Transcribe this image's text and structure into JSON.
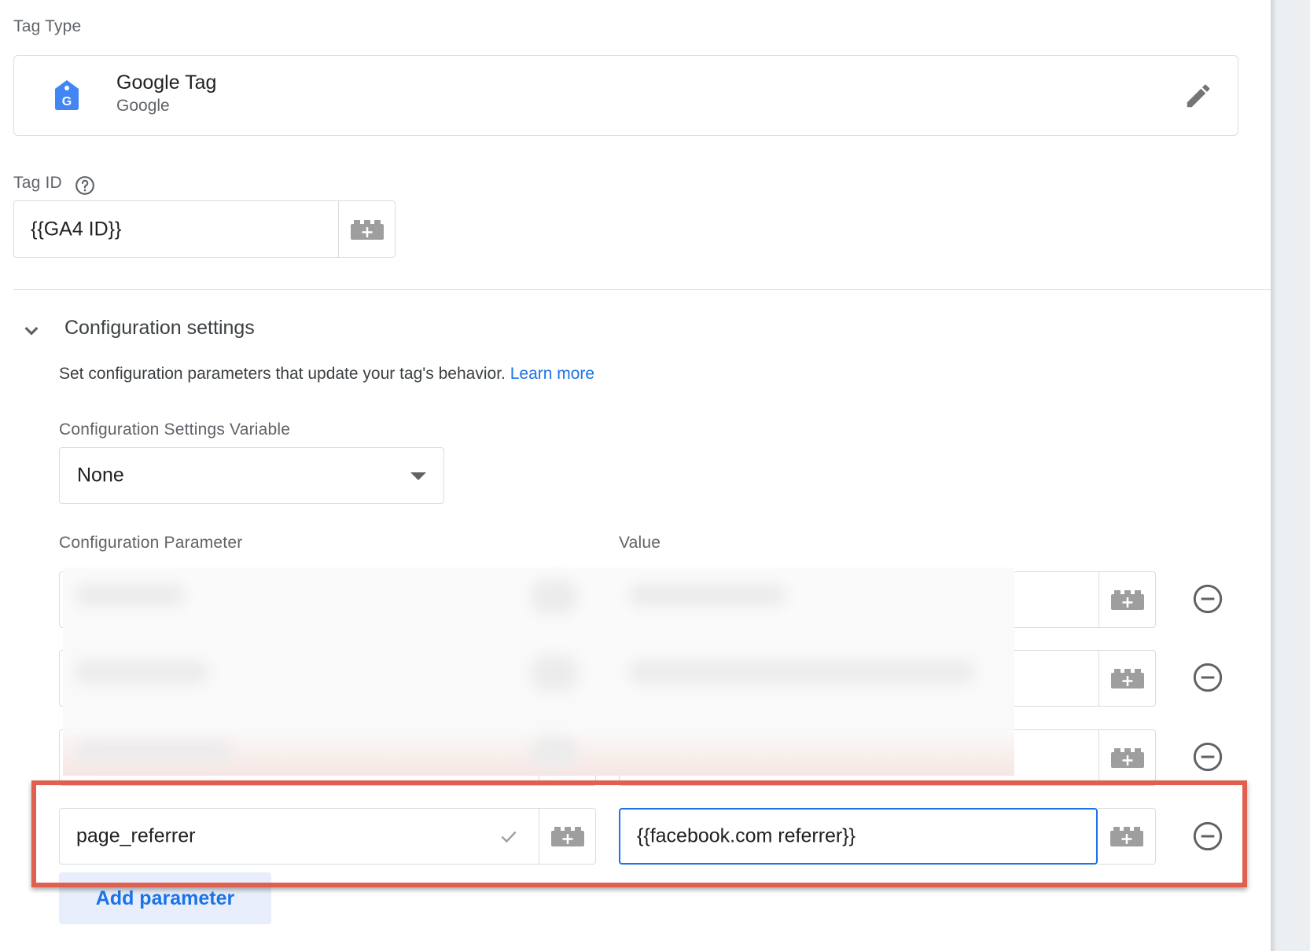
{
  "tag_type": {
    "label": "Tag Type",
    "name": "Google Tag",
    "vendor": "Google",
    "logo_letter": "G"
  },
  "tag_id": {
    "label": "Tag ID",
    "value": "{{GA4 ID}}"
  },
  "config_section": {
    "title": "Configuration settings",
    "description": "Set configuration parameters that update your tag's behavior.",
    "learn_more": "Learn more",
    "settings_variable_label": "Configuration Settings Variable",
    "settings_variable_value": "None",
    "param_column_label": "Configuration Parameter",
    "value_column_label": "Value",
    "visible_row": {
      "parameter": "page_referrer",
      "value": "{{facebook.com referrer}}"
    },
    "add_parameter_label": "Add parameter"
  },
  "colors": {
    "accent": "#1a73e8",
    "highlight_border": "#e0604f",
    "tag_icon_blue": "#4285f4"
  },
  "icons": [
    "google-tag-icon",
    "edit-pencil-icon",
    "help-icon",
    "add-variable-icon",
    "chevron-down-icon",
    "dropdown-caret-icon",
    "remove-row-icon",
    "checkmark-icon"
  ]
}
